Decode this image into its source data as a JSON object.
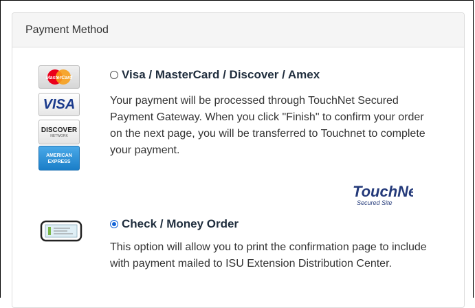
{
  "panel": {
    "heading": "Payment Method"
  },
  "options": [
    {
      "label": "Visa / MasterCard / Discover / Amex",
      "selected": false,
      "description": "Your payment will be processed through TouchNet Secured Payment Gateway. When you click \"Finish\" to confirm your order on the next page, you will be transferred to Touchnet to complete your payment.",
      "icons": [
        "mastercard-icon",
        "visa-icon",
        "discover-icon",
        "amex-icon"
      ],
      "card_text": {
        "mastercard": "MasterCard",
        "visa": "VISA",
        "discover": "DISCOVER",
        "discover_sub": "NETWORK",
        "amex_line1": "AMERICAN",
        "amex_line2": "EXPRESS"
      }
    },
    {
      "label": "Check / Money Order",
      "selected": true,
      "description": "This option will allow you to print the confirmation page to include with payment mailed to ISU Extension Distribution Center.",
      "icons": [
        "check-icon"
      ]
    }
  ],
  "touchnet_logo": {
    "brand": "TouchNet",
    "tagline": "Secured Site"
  },
  "colors": {
    "accent": "#1565d8",
    "title": "#1f2d3d",
    "text": "#333333",
    "heading_bg": "#f5f5f5"
  }
}
